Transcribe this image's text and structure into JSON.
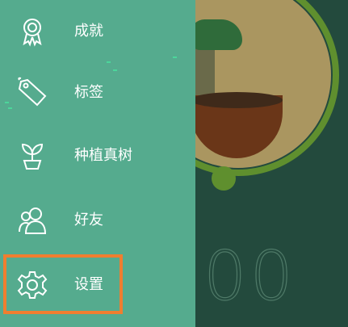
{
  "drawer": {
    "items": [
      {
        "label": "成就",
        "icon": "achievement-medal-icon"
      },
      {
        "label": "标签",
        "icon": "tag-icon"
      },
      {
        "label": "种植真树",
        "icon": "sprout-icon"
      },
      {
        "label": "好友",
        "icon": "friends-icon"
      },
      {
        "label": "设置",
        "icon": "gear-icon"
      }
    ]
  },
  "timer": {
    "display": "00"
  },
  "colors": {
    "drawer_bg": "#55ab8e",
    "main_bg": "#234a3d",
    "highlight": "#f07e2f",
    "ring": "#5f8f2e"
  }
}
